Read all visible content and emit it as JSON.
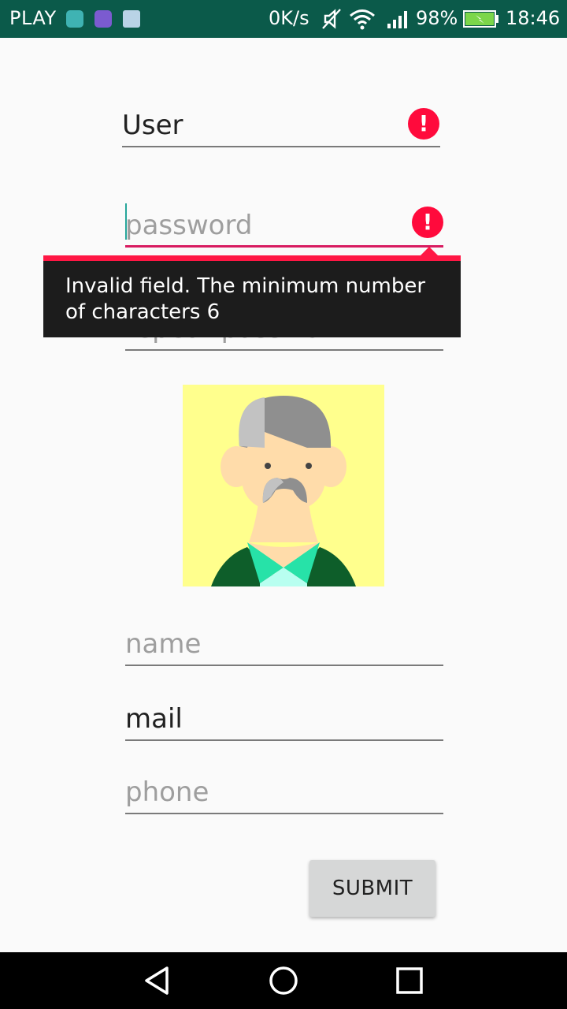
{
  "status_bar": {
    "carrier": "PLAY",
    "net_speed": "0K/s",
    "battery_percent": "98%",
    "time": "18:46",
    "icons": [
      "android-notification-icon",
      "image-notification-icon",
      "mail-notification-icon",
      "mute-icon",
      "wifi-icon",
      "signal-icon",
      "battery-charging-icon"
    ]
  },
  "form": {
    "user": {
      "value": "User",
      "placeholder": ""
    },
    "password": {
      "value": "",
      "placeholder": "password"
    },
    "repeat_password": {
      "value": "",
      "placeholder": "repeat password"
    },
    "error_message": "Invalid field. The minimum number of characters 6",
    "name": {
      "value": "",
      "placeholder": "name"
    },
    "mail": {
      "value": "mail",
      "placeholder": ""
    },
    "phone": {
      "value": "",
      "placeholder": "phone"
    },
    "submit_label": "SUBMIT"
  },
  "nav_bar": {
    "icons": [
      "back-icon",
      "home-icon",
      "recents-icon"
    ]
  },
  "colors": {
    "status_bar": "#0b5a4a",
    "error": "#ff0a3c",
    "error_line": "#d81b60",
    "caret": "#26a69a",
    "avatar_bg": "#ffff8d"
  }
}
